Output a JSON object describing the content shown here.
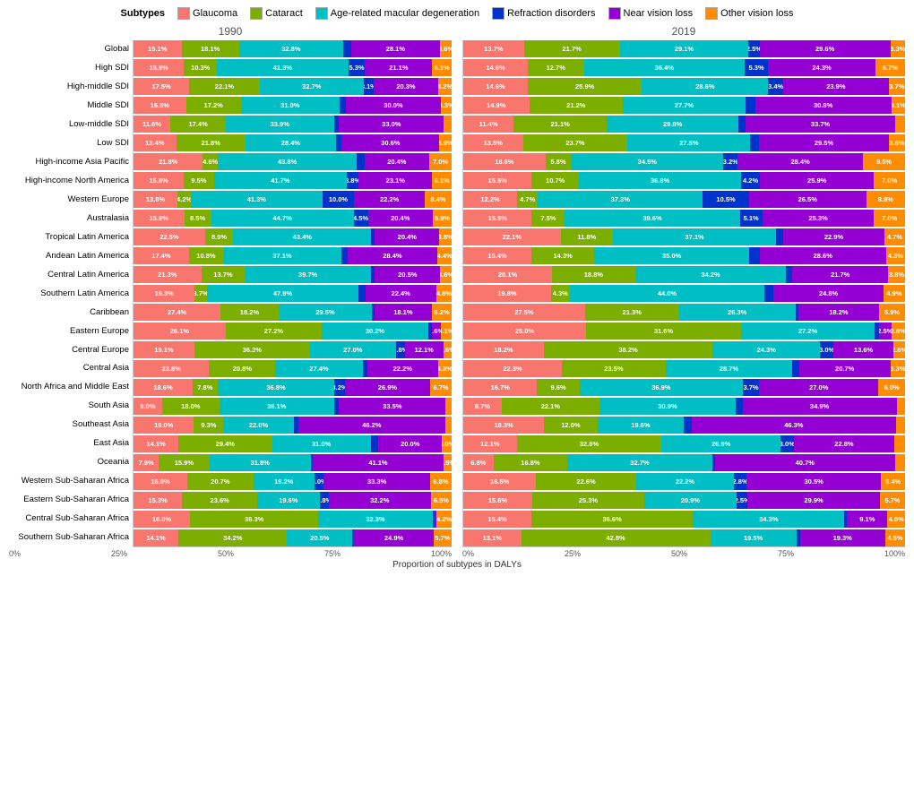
{
  "legend": {
    "items": [
      {
        "label": "Glaucoma",
        "color": "#F8766D"
      },
      {
        "label": "Cataract",
        "color": "#7CAE00"
      },
      {
        "label": "Age-related macular degeneration",
        "color": "#00BFC4"
      },
      {
        "label": "Refraction disorders",
        "color": "#0033cc"
      },
      {
        "label": "Near vision loss",
        "color": "#9400D3"
      },
      {
        "label": "Other vision loss",
        "color": "#FF8C00"
      }
    ]
  },
  "subtitle": "Subtypes",
  "xAxisLabel": "Proportion of subtypes in DALYs",
  "xTicks": [
    "0%",
    "25%",
    "50%",
    "75%",
    "100%"
  ],
  "year1": "1990",
  "year2": "2019",
  "rows": [
    {
      "label": "Global",
      "d1990": [
        15.1,
        18.1,
        32.8,
        2.4,
        28.1,
        3.6
      ],
      "d2019": [
        13.7,
        21.7,
        29.1,
        2.5,
        29.6,
        3.3
      ]
    },
    {
      "label": "High SDI",
      "d1990": [
        15.9,
        10.3,
        41.3,
        5.3,
        21.1,
        6.1
      ],
      "d2019": [
        14.6,
        12.7,
        36.4,
        5.3,
        24.3,
        6.7
      ]
    },
    {
      "label": "High-middle SDI",
      "d1990": [
        17.5,
        22.1,
        32.7,
        3.1,
        20.3,
        4.2
      ],
      "d2019": [
        14.6,
        25.9,
        28.6,
        3.4,
        23.9,
        3.7
      ]
    },
    {
      "label": "Middle SDI",
      "d1990": [
        16.5,
        17.2,
        31.0,
        1.9,
        30.0,
        3.3
      ],
      "d2019": [
        14.9,
        21.2,
        27.7,
        2.2,
        30.8,
        3.1
      ]
    },
    {
      "label": "Low-middle SDI",
      "d1990": [
        11.6,
        17.4,
        33.9,
        1.6,
        33.0,
        2.4
      ],
      "d2019": [
        11.4,
        21.1,
        29.8,
        1.7,
        33.7,
        2.3
      ]
    },
    {
      "label": "Low SDI",
      "d1990": [
        13.4,
        21.8,
        28.4,
        1.9,
        30.6,
        3.9
      ],
      "d2019": [
        13.5,
        23.7,
        27.8,
        1.9,
        29.5,
        3.6
      ]
    },
    {
      "label": "High-income Asia Pacific",
      "d1990": [
        21.8,
        4.6,
        43.8,
        2.3,
        20.4,
        7.0
      ],
      "d2019": [
        18.6,
        5.8,
        34.5,
        3.2,
        28.4,
        9.5
      ]
    },
    {
      "label": "High-income North America",
      "d1990": [
        15.8,
        9.5,
        41.7,
        3.8,
        23.1,
        6.1
      ],
      "d2019": [
        15.5,
        10.7,
        36.8,
        4.2,
        25.9,
        7.0
      ]
    },
    {
      "label": "Western Europe",
      "d1990": [
        13.8,
        4.2,
        41.3,
        10.0,
        22.2,
        8.4
      ],
      "d2019": [
        12.2,
        4.7,
        37.3,
        10.5,
        26.5,
        8.8
      ]
    },
    {
      "label": "Australasia",
      "d1990": [
        15.9,
        8.5,
        44.7,
        4.5,
        20.4,
        5.9
      ],
      "d2019": [
        15.5,
        7.5,
        39.6,
        5.1,
        25.3,
        7.0
      ]
    },
    {
      "label": "Tropical Latin America",
      "d1990": [
        22.5,
        8.9,
        43.4,
        1.1,
        20.4,
        3.8
      ],
      "d2019": [
        22.1,
        11.8,
        37.1,
        1.6,
        22.9,
        4.7
      ]
    },
    {
      "label": "Andean Latin America",
      "d1990": [
        17.4,
        10.8,
        37.1,
        1.9,
        28.4,
        4.4
      ],
      "d2019": [
        15.4,
        14.3,
        35.0,
        2.4,
        28.6,
        4.3
      ]
    },
    {
      "label": "Central Latin America",
      "d1990": [
        21.3,
        13.7,
        39.7,
        1.2,
        20.5,
        3.6
      ],
      "d2019": [
        20.1,
        18.8,
        34.2,
        1.4,
        21.7,
        3.8
      ]
    },
    {
      "label": "Southern Latin America",
      "d1990": [
        19.3,
        3.7,
        47.9,
        2.0,
        22.4,
        4.8
      ],
      "d2019": [
        19.8,
        4.3,
        44.0,
        2.1,
        24.8,
        4.9
      ]
    },
    {
      "label": "Caribbean",
      "d1990": [
        27.4,
        18.2,
        29.5,
        0.7,
        18.1,
        6.2
      ],
      "d2019": [
        27.5,
        21.3,
        26.3,
        0.7,
        18.2,
        5.9
      ]
    },
    {
      "label": "Eastern Europe",
      "d1990": [
        26.1,
        27.2,
        30.2,
        0.9,
        2.6,
        3.1
      ],
      "d2019": [
        25.0,
        31.6,
        27.2,
        0.9,
        2.5,
        2.8
      ]
    },
    {
      "label": "Central Europe",
      "d1990": [
        19.1,
        36.3,
        27.0,
        2.8,
        12.1,
        2.6
      ],
      "d2019": [
        18.2,
        38.2,
        24.3,
        3.0,
        13.6,
        2.6
      ]
    },
    {
      "label": "Central Asia",
      "d1990": [
        23.8,
        20.8,
        27.4,
        1.5,
        22.2,
        4.3
      ],
      "d2019": [
        22.3,
        23.5,
        28.7,
        1.5,
        20.7,
        3.3
      ]
    },
    {
      "label": "North Africa and Middle East",
      "d1990": [
        18.6,
        7.8,
        36.8,
        3.2,
        26.9,
        6.7
      ],
      "d2019": [
        16.7,
        9.6,
        36.9,
        3.7,
        27.0,
        6.0
      ]
    },
    {
      "label": "South Asia",
      "d1990": [
        9.0,
        18.0,
        36.1,
        1.6,
        33.5,
        1.9
      ],
      "d2019": [
        8.7,
        22.1,
        30.9,
        1.5,
        34.9,
        1.9
      ]
    },
    {
      "label": "Southeast Asia",
      "d1990": [
        19.0,
        9.3,
        22.0,
        1.5,
        46.2,
        2.0
      ],
      "d2019": [
        18.3,
        12.0,
        19.6,
        1.7,
        46.3,
        2.0
      ]
    },
    {
      "label": "East Asia",
      "d1990": [
        14.1,
        29.4,
        31.0,
        2.4,
        20.0,
        3.0
      ],
      "d2019": [
        12.1,
        32.8,
        26.9,
        3.0,
        22.8,
        2.4
      ]
    },
    {
      "label": "Oceania",
      "d1990": [
        7.9,
        15.9,
        31.8,
        0.6,
        41.1,
        2.5
      ],
      "d2019": [
        6.8,
        16.8,
        32.7,
        0.7,
        40.7,
        2.3
      ]
    },
    {
      "label": "Western Sub-Saharan Africa",
      "d1990": [
        16.9,
        20.7,
        19.2,
        3.0,
        33.3,
        6.8
      ],
      "d2019": [
        16.5,
        22.6,
        22.2,
        2.8,
        30.5,
        5.4
      ]
    },
    {
      "label": "Eastern Sub-Saharan Africa",
      "d1990": [
        15.3,
        23.6,
        19.6,
        2.8,
        32.2,
        6.5
      ],
      "d2019": [
        15.6,
        25.3,
        20.9,
        2.5,
        29.9,
        5.7
      ]
    },
    {
      "label": "Central Sub-Saharan Africa",
      "d1990": [
        16.0,
        36.3,
        32.3,
        0.6,
        0.6,
        4.2
      ],
      "d2019": [
        15.4,
        36.6,
        34.3,
        0.6,
        9.1,
        4.0
      ]
    },
    {
      "label": "Southern Sub-Saharan Africa",
      "d1990": [
        14.1,
        34.2,
        20.5,
        0.6,
        24.9,
        5.7
      ],
      "d2019": [
        13.1,
        42.8,
        19.5,
        0.8,
        19.3,
        4.5
      ]
    }
  ],
  "colors": [
    "#F8766D",
    "#7CAE00",
    "#00BFC4",
    "#0033cc",
    "#9400D3",
    "#FF8C00"
  ]
}
